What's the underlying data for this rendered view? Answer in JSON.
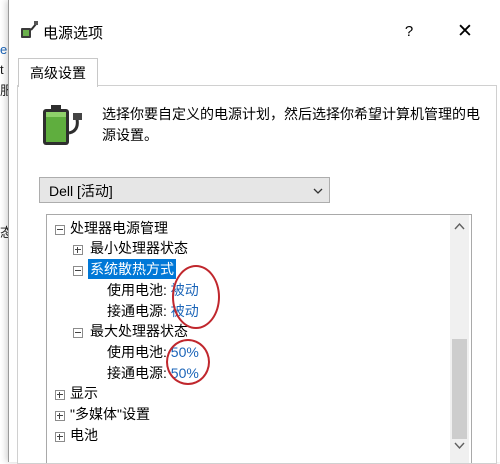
{
  "background_window": {
    "fragments": [
      "e",
      "t",
      "服",
      "态"
    ]
  },
  "dialog": {
    "title": "电源选项",
    "help_label": "?",
    "close_label": "✕"
  },
  "tabs": [
    {
      "label": "高级设置",
      "active": true
    }
  ],
  "description": "选择你要自定义的电源计划，然后选择你希望计算机管理的电源设置。",
  "plan_select": {
    "value": "Dell [活动]"
  },
  "tree": {
    "processor": "处理器电源管理",
    "min_state": "最小处理器状态",
    "cooling": "系统散热方式",
    "cooling_battery_label": "使用电池:",
    "cooling_battery_value": "被动",
    "cooling_ac_label": "接通电源:",
    "cooling_ac_value": "被动",
    "max_state": "最大处理器状态",
    "max_battery_label": "使用电池:",
    "max_battery_value": "50%",
    "max_ac_label": "接通电源:",
    "max_ac_value": "50%",
    "display": "显示",
    "multimedia": "\"多媒体\"设置",
    "battery": "电池"
  },
  "colors": {
    "selection": "#0078d7",
    "value_link": "#1a64b8",
    "annotation": "#c0272d"
  },
  "icons": [
    "power-plan-icon",
    "battery-icon",
    "chevron-down-icon",
    "scroll-up-icon",
    "scroll-down-icon"
  ]
}
